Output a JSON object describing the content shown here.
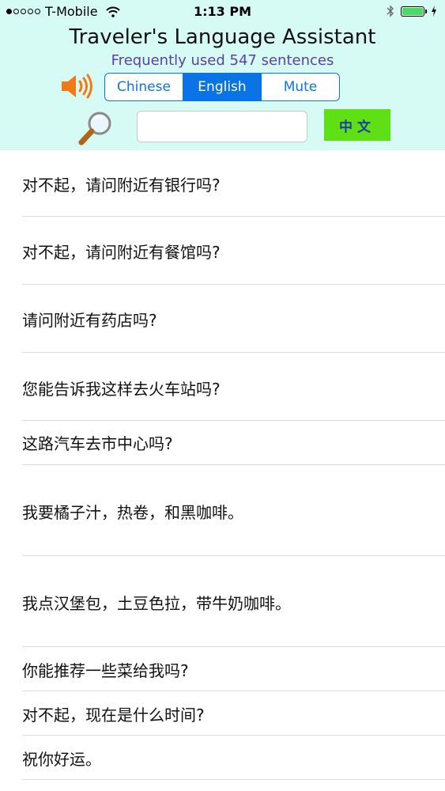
{
  "status_bar": {
    "carrier": "T-Mobile",
    "time": "1:13 PM",
    "signal_dots_filled": 1,
    "signal_dots_total": 5,
    "battery_level": 1.0,
    "battery_color": "#4cd964"
  },
  "header": {
    "title": "Traveler's Language Assistant",
    "subtitle": "Frequently used 547 sentences",
    "background": "#d6fbf4",
    "segments": [
      "Chinese",
      "English",
      "Mute"
    ],
    "selected_segment": "English",
    "search": {
      "value": "",
      "placeholder": ""
    },
    "chinese_button_label": "中文",
    "chinese_button_color": "#5ee014",
    "accent": "#0a74e6"
  },
  "phrases": [
    "对不起，请问附近有银行吗?",
    "对不起，请问附近有餐馆吗?",
    "请问附近有药店吗?",
    "您能告诉我这样去火车站吗?",
    "这路汽车去市中心吗?",
    "我要橘子汁，热卷，和黑咖啡。",
    "我点汉堡包，土豆色拉，带牛奶咖啡。",
    "你能推荐一些菜给我吗?",
    "对不起，现在是什么时间?",
    "祝你好运。"
  ]
}
